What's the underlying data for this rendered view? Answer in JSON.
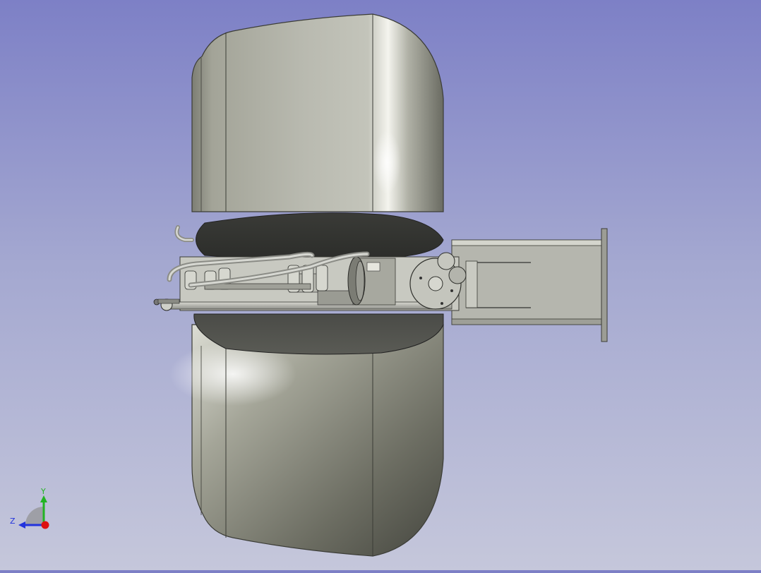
{
  "viewport": {
    "background_top": "#7d80c6",
    "background_bottom": "#c5c7db",
    "model_color": "#a9aa9f"
  },
  "axis_indicator": {
    "y_label": "Y",
    "z_label": "Z",
    "y_color": "#22b422",
    "z_color": "#2233dd",
    "x_color": "#dd1111"
  }
}
